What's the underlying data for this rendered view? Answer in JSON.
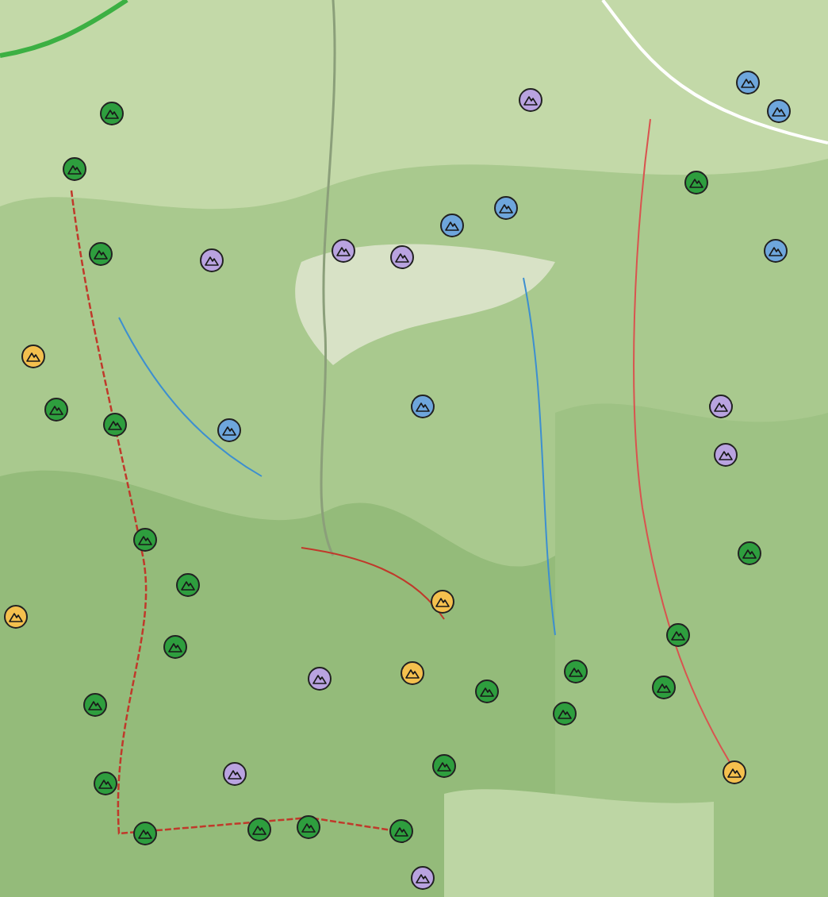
{
  "map": {
    "kind": "picture",
    "markers": [
      {
        "color": "#2e9e3e"
      },
      {
        "color": "#2e9e3e"
      },
      {
        "color": "#2e9e3e"
      },
      {
        "color": "#b9a3e0"
      },
      {
        "color": "#b9a3e0"
      },
      {
        "color": "#b9a3e0"
      },
      {
        "color": "#6ea6dc"
      },
      {
        "color": "#6ea6dc"
      },
      {
        "color": "#b9a3e0"
      },
      {
        "color": "#6ea6dc"
      },
      {
        "color": "#6ea6dc"
      },
      {
        "color": "#2e9e3e"
      },
      {
        "color": "#6ea6dc"
      },
      {
        "color": "#f4c04e"
      },
      {
        "color": "#2e9e3e"
      },
      {
        "color": "#2e9e3e"
      },
      {
        "color": "#6ea6dc"
      },
      {
        "color": "#6ea6dc"
      },
      {
        "color": "#b9a3e0"
      },
      {
        "color": "#b9a3e0"
      },
      {
        "color": "#2e9e3e"
      },
      {
        "color": "#2e9e3e"
      },
      {
        "color": "#2e9e3e"
      },
      {
        "color": "#f4c04e"
      },
      {
        "color": "#f4c04e"
      },
      {
        "color": "#2e9e3e"
      },
      {
        "color": "#2e9e3e"
      },
      {
        "color": "#b9a3e0"
      },
      {
        "color": "#f4c04e"
      },
      {
        "color": "#2e9e3e"
      },
      {
        "color": "#2e9e3e"
      },
      {
        "color": "#2e9e3e"
      },
      {
        "color": "#2e9e3e"
      },
      {
        "color": "#2e9e3e"
      },
      {
        "color": "#2e9e3e"
      },
      {
        "color": "#b9a3e0"
      },
      {
        "color": "#f4c04e"
      },
      {
        "color": "#2e9e3e"
      },
      {
        "color": "#2e9e3e"
      },
      {
        "color": "#2e9e3e"
      },
      {
        "color": "#2e9e3e"
      },
      {
        "color": "#2e9e3e"
      },
      {
        "color": "#b9a3e0"
      }
    ]
  }
}
